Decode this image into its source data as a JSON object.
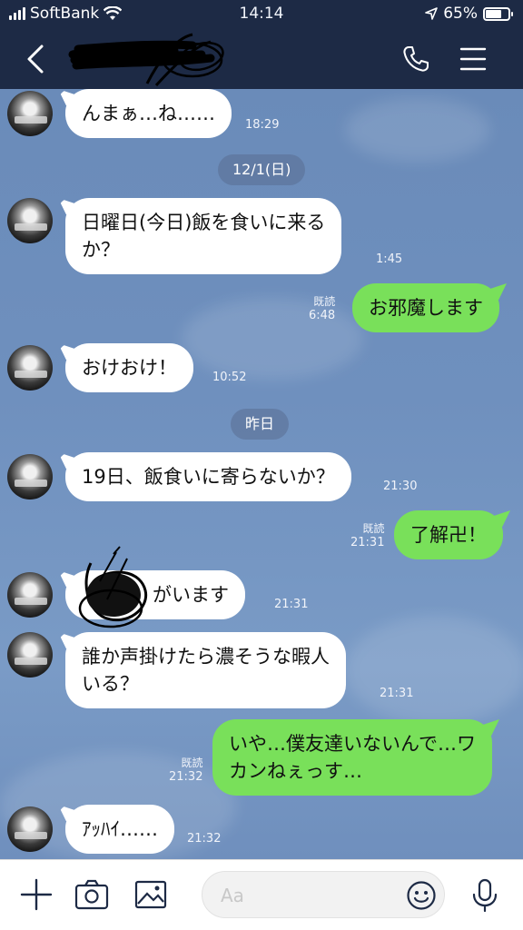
{
  "status_bar": {
    "carrier": "SoftBank",
    "time": "14:14",
    "battery": "65%",
    "battery_level": 0.65
  },
  "header": {
    "back_icon": "chevron-left-icon",
    "call_icon": "phone-icon",
    "menu_icon": "hamburger-menu-icon"
  },
  "messages": [
    {
      "dir": "in",
      "text": "んまぁ…ね……",
      "time": "18:29"
    },
    {
      "type": "date",
      "text": "12/1(日)"
    },
    {
      "dir": "in",
      "text_line1": "日曜日(今日)飯を食いに来る",
      "text_line2": "か？",
      "time": "1:45"
    },
    {
      "dir": "out",
      "text": "お邪魔します",
      "read": "既読",
      "time": "6:48"
    },
    {
      "dir": "in",
      "text": "おけおけ！",
      "time": "10:52"
    },
    {
      "type": "date",
      "text": "昨日"
    },
    {
      "dir": "in",
      "text": "19日、飯食いに寄らないか？",
      "time": "21:30"
    },
    {
      "dir": "out",
      "text": "了解卍！",
      "read": "既読",
      "time": "21:31"
    },
    {
      "dir": "in",
      "text": "がいます",
      "time": "21:31"
    },
    {
      "dir": "in",
      "text_line1": "誰か声掛けたら濃そうな暇人",
      "text_line2": "いる？",
      "time": "21:31"
    },
    {
      "dir": "out",
      "text_line1": "いや…僕友達いないんで…ワ",
      "text_line2": "カンねぇっす…",
      "read": "既読",
      "time": "21:32"
    },
    {
      "dir": "in",
      "text": "ｱｯﾊｲ……",
      "time": "21:32"
    }
  ],
  "input_bar": {
    "placeholder": "Aa",
    "icons": [
      "plus-icon",
      "camera-icon",
      "image-icon",
      "emoji-icon",
      "microphone-icon"
    ]
  },
  "colors": {
    "header_bg": "#1d2a45",
    "chat_bg": "#6f8fbd",
    "out_bubble": "#79e05a",
    "in_bubble": "#ffffff"
  }
}
